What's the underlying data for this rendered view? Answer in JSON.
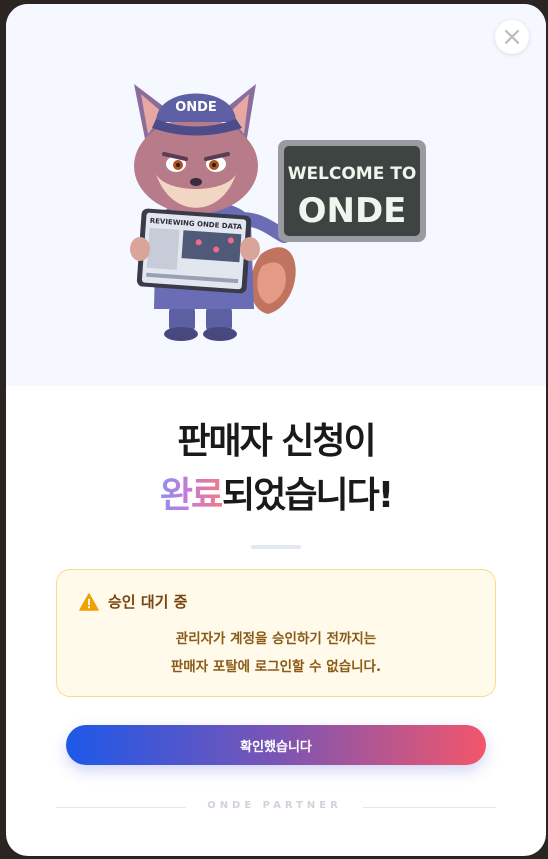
{
  "modal": {
    "close_label": "×",
    "title_line1": "판매자 신청이",
    "title_line2_highlight": "완료",
    "title_line2_rest": "되었습니다!",
    "illustration": {
      "cap_text": "ONDE",
      "sign_line1": "WELCOME TO",
      "sign_line2": "ONDE",
      "tablet_title": "REVIEWING ONDE DATA"
    },
    "warning": {
      "icon": "warning-icon",
      "title": "승인 대기 중",
      "line1": "관리자가 계정을 승인하기 전까지는",
      "line2": "판매자 포탈에 로그인할 수 없습니다."
    },
    "confirm_button": "확인했습니다",
    "footer_brand": "ONDE PARTNER",
    "colors": {
      "brand_gradient_start": "#1d58e8",
      "brand_gradient_end": "#f2566a",
      "warning": "#f0a000"
    }
  }
}
